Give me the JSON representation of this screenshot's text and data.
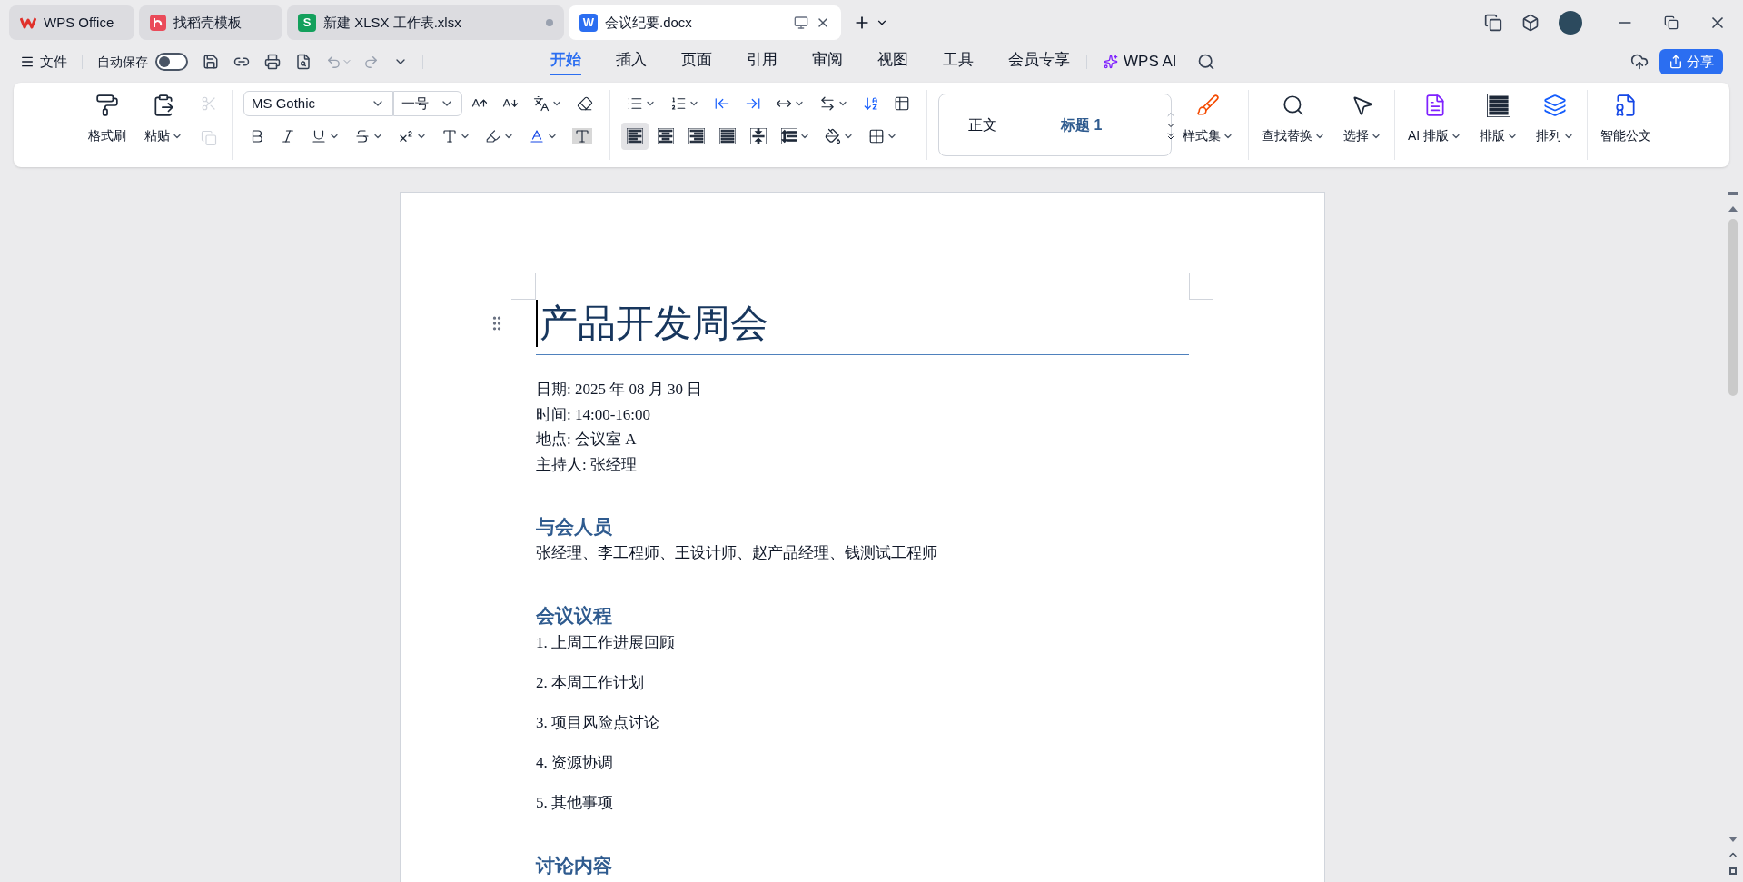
{
  "tabs": [
    {
      "kind": "wps",
      "label": "WPS Office",
      "selected": false
    },
    {
      "kind": "template",
      "label": "找稻壳模板",
      "selected": false
    },
    {
      "kind": "sheet",
      "badge": "S",
      "label": "新建 XLSX 工作表.xlsx",
      "selected": false
    },
    {
      "kind": "doc",
      "badge": "W",
      "label": "会议纪要.docx",
      "selected": true
    }
  ],
  "menu": {
    "file": "文件",
    "autosave": {
      "label": "自动保存",
      "on": false
    },
    "ribbon_tabs": [
      {
        "label": "开始",
        "selected": true
      },
      {
        "label": "插入",
        "selected": false
      },
      {
        "label": "页面",
        "selected": false
      },
      {
        "label": "引用",
        "selected": false
      },
      {
        "label": "审阅",
        "selected": false
      },
      {
        "label": "视图",
        "selected": false
      },
      {
        "label": "工具",
        "selected": false
      },
      {
        "label": "会员专享",
        "selected": false
      }
    ],
    "ai": "WPS AI",
    "share": "分享"
  },
  "ribbon": {
    "clipboard": [
      {
        "kind": "format-painter",
        "label": "格式刷",
        "caret": false
      },
      {
        "kind": "paste",
        "label": "粘贴",
        "caret": true
      }
    ],
    "clipboard_small": [
      {
        "kind": "cut",
        "disabled": true
      },
      {
        "kind": "copy",
        "disabled": true
      }
    ],
    "font": {
      "name": "MS Gothic",
      "size": "一号",
      "row1": [
        {
          "kind": "grow",
          "caret": false
        },
        {
          "kind": "shrink",
          "caret": false
        },
        {
          "kind": "phonetic",
          "caret": true
        },
        {
          "kind": "clear",
          "caret": false
        }
      ],
      "row2": [
        {
          "kind": "bold",
          "caret": false
        },
        {
          "kind": "italic",
          "caret": false
        },
        {
          "kind": "underline",
          "caret": true
        },
        {
          "kind": "strike",
          "caret": true
        },
        {
          "kind": "superscript",
          "caret": true
        },
        {
          "kind": "effect",
          "caret": true
        },
        {
          "kind": "highlight",
          "caret": true
        },
        {
          "kind": "font-color",
          "caret": true
        },
        {
          "kind": "shading",
          "caret": false
        }
      ]
    },
    "paragraph": {
      "row1": [
        {
          "kind": "bullets",
          "caret": true
        },
        {
          "kind": "numbering",
          "caret": true
        },
        {
          "kind": "outdent",
          "caret": false
        },
        {
          "kind": "indent",
          "caret": false
        },
        {
          "kind": "spacing",
          "caret": true
        },
        {
          "kind": "direction",
          "caret": true
        },
        {
          "kind": "sort",
          "caret": false
        },
        {
          "kind": "table",
          "caret": false
        }
      ],
      "row2": [
        {
          "kind": "align-left",
          "caret": false,
          "selected": true
        },
        {
          "kind": "align-center",
          "caret": false,
          "selected": false
        },
        {
          "kind": "align-right",
          "caret": false,
          "selected": false
        },
        {
          "kind": "justify",
          "caret": false,
          "selected": false
        },
        {
          "kind": "distribute",
          "caret": false,
          "selected": false
        },
        {
          "kind": "line-spacing",
          "caret": true,
          "selected": false
        },
        {
          "kind": "fill",
          "caret": true,
          "selected": false
        },
        {
          "kind": "borders",
          "caret": true,
          "selected": false
        }
      ]
    },
    "styles": [
      {
        "kind": "body",
        "label": "正文"
      },
      {
        "kind": "heading",
        "label": "标题 1"
      }
    ],
    "style_set": "样式集",
    "actions": [
      {
        "kind": "find",
        "label": "查找替换",
        "caret": true
      },
      {
        "kind": "select",
        "label": "选择",
        "caret": true
      },
      {
        "kind": "ai-layout",
        "label": "AI 排版",
        "caret": true
      },
      {
        "kind": "layout",
        "label": "排版",
        "caret": true
      },
      {
        "kind": "arrange",
        "label": "排列",
        "caret": true
      },
      {
        "kind": "smart-doc",
        "label": "智能公文",
        "caret": false
      }
    ]
  },
  "document": {
    "title": "产品开发周会",
    "meta": [
      "日期: 2025 年 08 月 30 日",
      "时间: 14:00-16:00",
      "地点: 会议室 A",
      "主持人: 张经理"
    ],
    "sections": [
      {
        "heading": "与会人员",
        "kind": "paragraph",
        "items": [
          "张经理、李工程师、王设计师、赵产品经理、钱测试工程师"
        ]
      },
      {
        "heading": "会议议程",
        "kind": "list",
        "items": [
          "1. 上周工作进展回顾",
          "2. 本周工作计划",
          "3. 项目风险点讨论",
          "4. 资源协调",
          "5. 其他事项"
        ]
      },
      {
        "heading": "讨论内容",
        "kind": "heading-only"
      }
    ]
  }
}
